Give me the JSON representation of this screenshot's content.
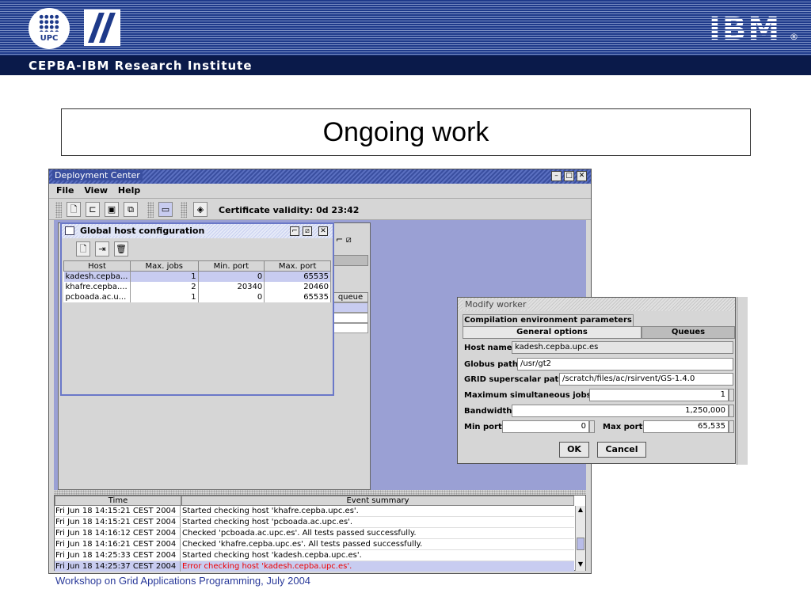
{
  "slide": {
    "institute": "CEPBA-IBM Research Institute",
    "upc_label": "UPC",
    "ibm_label": "IBM",
    "ibm_reg": "®",
    "title": "Ongoing work",
    "footer": "Workshop on Grid Applications Programming, July 2004"
  },
  "window": {
    "title": "Deployment Center",
    "menu": [
      "File",
      "View",
      "Help"
    ],
    "certificate": "Certificate validity: 0d 23:42"
  },
  "host_config": {
    "title": "Global host configuration",
    "columns": [
      "Host",
      "Max. jobs",
      "Min. port",
      "Max. port"
    ],
    "rows": [
      [
        "kadesh.cepba...",
        "1",
        "0",
        "65535"
      ],
      [
        "khafre.cepba....",
        "2",
        "20340",
        "20460"
      ],
      [
        "pcboada.ac.u...",
        "1",
        "0",
        "65535"
      ]
    ],
    "behind_header": "queue"
  },
  "event_log": {
    "columns": [
      "Time",
      "Event summary"
    ],
    "rows": [
      [
        "Fri Jun 18 14:15:21 CEST 2004",
        "Started checking host 'khafre.cepba.upc.es'."
      ],
      [
        "Fri Jun 18 14:15:21 CEST 2004",
        "Started checking host 'pcboada.ac.upc.es'."
      ],
      [
        "Fri Jun 18 14:16:12 CEST 2004",
        "Checked 'pcboada.ac.upc.es'. All tests passed successfully."
      ],
      [
        "Fri Jun 18 14:16:21 CEST 2004",
        "Checked 'khafre.cepba.upc.es'. All tests passed successfully."
      ],
      [
        "Fri Jun 18 14:25:33 CEST 2004",
        "Started checking host 'kadesh.cepba.upc.es'."
      ],
      [
        "Fri Jun 18 14:25:37 CEST 2004",
        "Error checking host 'kadesh.cepba.upc.es'."
      ]
    ]
  },
  "modify_worker": {
    "title": "Modify worker",
    "tabs": [
      "Compilation environment parameters",
      "General options",
      "Queues"
    ],
    "host_name_label": "Host name",
    "host_name": "kadesh.cepba.upc.es",
    "globus_label": "Globus path",
    "globus": "/usr/gt2",
    "gridss_label": "GRID superscalar path",
    "gridss": "/scratch/files/ac/rsirvent/GS-1.4.0",
    "maxjobs_label": "Maximum simultaneous jobs",
    "maxjobs": "1",
    "bandwidth_label": "Bandwidth",
    "bandwidth": "1,250,000",
    "minport_label": "Min port",
    "minport": "0",
    "maxport_label": "Max port",
    "maxport": "65,535",
    "ok": "OK",
    "cancel": "Cancel"
  },
  "colors": {
    "accent": "#9aa0d4",
    "header": "#0a1a4a",
    "error": "#e00000",
    "selection": "#c8ccf0"
  }
}
